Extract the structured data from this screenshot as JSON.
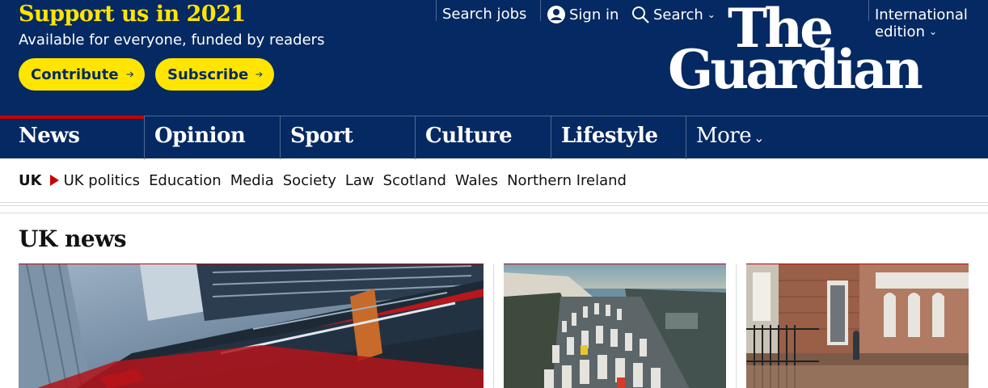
{
  "support": {
    "title": "Support us in 2021",
    "subtitle": "Available for everyone, funded by readers",
    "contribute_label": "Contribute",
    "subscribe_label": "Subscribe"
  },
  "header_links": {
    "search_jobs": "Search jobs",
    "sign_in": "Sign in",
    "search": "Search",
    "edition_line1": "International",
    "edition_line2": "edition"
  },
  "logo": {
    "line1": "The",
    "line2": "Guardian"
  },
  "nav": {
    "items": [
      {
        "label": "News"
      },
      {
        "label": "Opinion"
      },
      {
        "label": "Sport"
      },
      {
        "label": "Culture"
      },
      {
        "label": "Lifestyle"
      }
    ],
    "more_label": "More"
  },
  "subnav": {
    "current": "UK",
    "links": [
      "UK politics",
      "Education",
      "Media",
      "Society",
      "Law",
      "Scotland",
      "Wales",
      "Northern Ireland"
    ]
  },
  "section": {
    "title": "UK news"
  },
  "colors": {
    "brand_blue": "#052962",
    "brand_yellow": "#ffe500",
    "accent_red": "#c70000"
  },
  "icons": [
    "arrow-right-icon",
    "user-icon",
    "search-icon",
    "chevron-down-icon",
    "triangle-right-icon"
  ]
}
